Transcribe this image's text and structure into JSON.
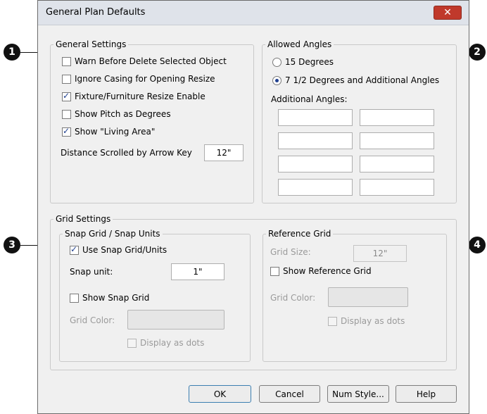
{
  "dialog": {
    "title": "General Plan Defaults"
  },
  "callouts": [
    "1",
    "2",
    "3",
    "4"
  ],
  "general_settings": {
    "legend": "General Settings",
    "checkboxes": [
      {
        "label": "Warn Before Delete Selected Object",
        "checked": false
      },
      {
        "label": "Ignore Casing for Opening Resize",
        "checked": false
      },
      {
        "label": "Fixture/Furniture Resize Enable",
        "checked": true
      },
      {
        "label": "Show Pitch as Degrees",
        "checked": false
      },
      {
        "label": "Show \"Living Area\"",
        "checked": true
      }
    ],
    "distance_label": "Distance Scrolled by Arrow Key",
    "distance_value": "12\""
  },
  "allowed_angles": {
    "legend": "Allowed Angles",
    "options": [
      {
        "label": "15 Degrees",
        "selected": false
      },
      {
        "label": "7 1/2 Degrees and Additional Angles",
        "selected": true
      }
    ],
    "additional_label": "Additional Angles:"
  },
  "grid_settings": {
    "legend": "Grid Settings",
    "snap": {
      "legend": "Snap Grid / Snap Units",
      "use_snap_label": "Use Snap Grid/Units",
      "use_snap_checked": true,
      "snap_unit_label": "Snap unit:",
      "snap_unit_value": "1\"",
      "show_snap_label": "Show Snap Grid",
      "grid_color_label": "Grid Color:",
      "display_dots_label": "Display as dots"
    },
    "reference": {
      "legend": "Reference Grid",
      "grid_size_label": "Grid Size:",
      "grid_size_value": "12\"",
      "show_reference_label": "Show Reference Grid",
      "grid_color_label": "Grid Color:",
      "display_dots_label": "Display as dots"
    }
  },
  "buttons": {
    "ok": "OK",
    "cancel": "Cancel",
    "num_style": "Num Style...",
    "help": "Help"
  },
  "colors": {
    "dialog_bg": "#f0f0f0",
    "close_button": "#c0392b",
    "callout": "#111111",
    "check_accent": "#1f3f8f"
  }
}
